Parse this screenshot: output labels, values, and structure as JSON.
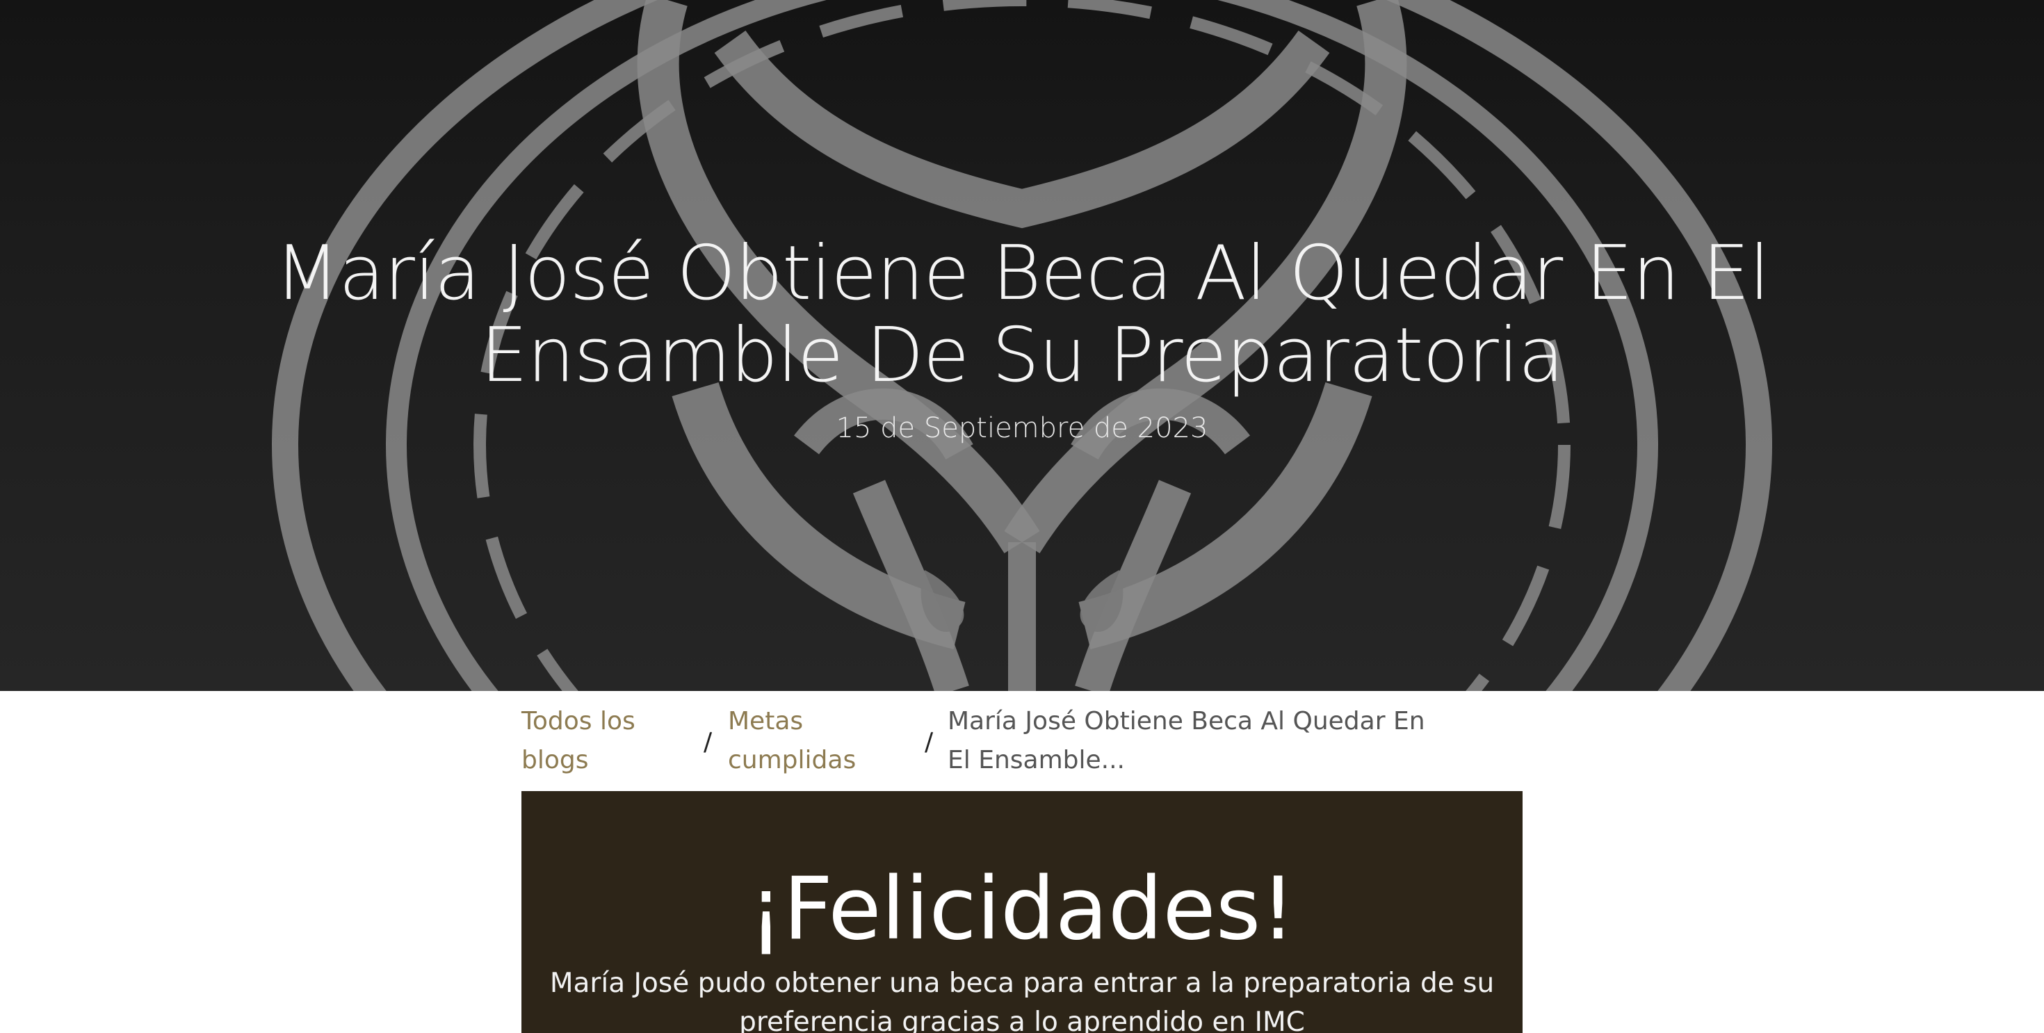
{
  "hero": {
    "title": "María José Obtiene Beca Al Quedar En El Ensamble De Su Preparatoria",
    "date": "15 de Septiembre de 2023",
    "background_icon": "owl-emblem-icon"
  },
  "breadcrumb": {
    "items": [
      {
        "label": "Todos los blogs"
      },
      {
        "label": "Metas cumplidas"
      },
      {
        "label": "María José Obtiene Beca Al Quedar En El Ensamble..."
      }
    ],
    "separator": "/"
  },
  "panel": {
    "title": "¡Felicidades!",
    "body": "María José pudo obtener una beca para entrar a la preparatoria de su preferencia gracias a lo aprendido en IMC"
  },
  "colors": {
    "link": "#8d7b51",
    "panel_bg": "#2d2518",
    "hero_bg": "#1c1c1c"
  }
}
